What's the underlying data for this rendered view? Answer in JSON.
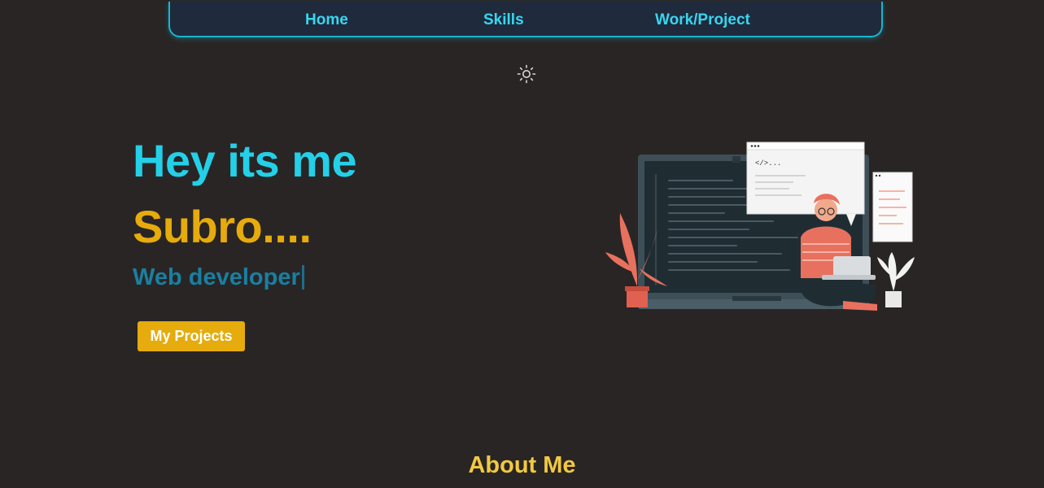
{
  "nav": {
    "items": [
      {
        "label": "Home"
      },
      {
        "label": "Skills"
      },
      {
        "label": "Work/Project"
      }
    ]
  },
  "theme_toggle": {
    "icon": "sun-icon"
  },
  "hero": {
    "greeting": "Hey its me",
    "name": "Subro....",
    "role": "Web developer",
    "button_label": "My Projects",
    "illustration": {
      "code_tag": "</>..."
    }
  },
  "about": {
    "heading": "About Me"
  },
  "colors": {
    "background": "#292525",
    "nav_bg": "#1f2a3d",
    "accent_cyan": "#23d0e8",
    "accent_gold": "#e6ab0c",
    "role_blue": "#1a7fa0",
    "about_yellow": "#f3c842"
  }
}
